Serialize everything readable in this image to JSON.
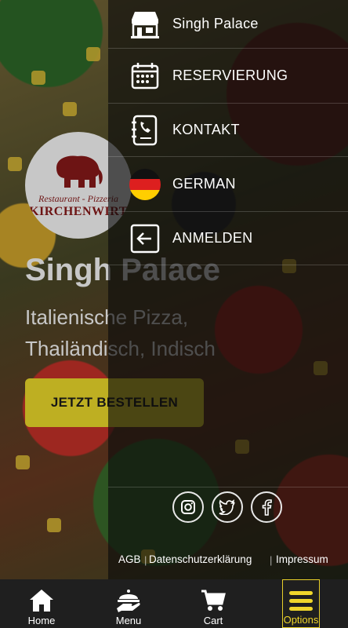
{
  "hero": {
    "logo_line1": "Restaurant - Pizzeria",
    "logo_line2": "KIRCHENWIRT",
    "title": "Singh Palace",
    "subtitle": "Italienische Pizza, Thailändisch, Indisch",
    "order_button": "JETZT BESTELLEN"
  },
  "drawer": {
    "items": [
      {
        "label": "Singh Palace",
        "icon": "restaurant-icon"
      },
      {
        "label": "RESERVIERUNG",
        "icon": "calendar-icon"
      },
      {
        "label": "KONTAKT",
        "icon": "contact-book-icon"
      },
      {
        "label": "GERMAN",
        "icon": "german-flag-icon"
      },
      {
        "label": "ANMELDEN",
        "icon": "login-icon"
      }
    ],
    "social": [
      "instagram-icon",
      "twitter-icon",
      "facebook-icon"
    ],
    "legal": [
      "AGB",
      "Datenschutzerklärung",
      "Impressum"
    ]
  },
  "bottom_nav": {
    "items": [
      {
        "label": "Home",
        "icon": "home-icon"
      },
      {
        "label": "Menu",
        "icon": "serving-hand-icon"
      },
      {
        "label": "Cart",
        "icon": "cart-icon"
      },
      {
        "label": "Options",
        "icon": "hamburger-icon",
        "active": true
      }
    ]
  },
  "colors": {
    "accent": "#f4e02c",
    "drawer_bg": "#0a0a0a",
    "nav_bg": "#1f1f1f",
    "logo_red": "#8c1a1a"
  }
}
